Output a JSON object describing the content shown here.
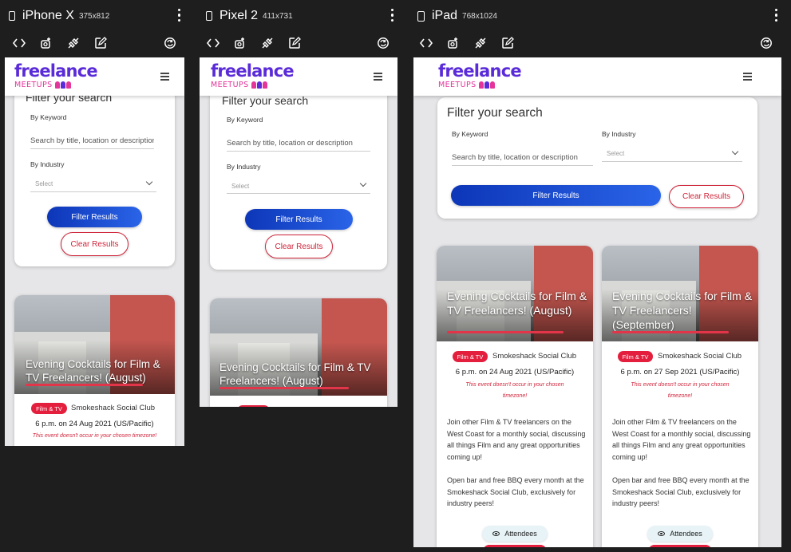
{
  "devices": [
    {
      "name": "iPhone X",
      "dims": "375x812"
    },
    {
      "name": "Pixel 2",
      "dims": "411x731"
    },
    {
      "name": "iPad",
      "dims": "768x1024"
    }
  ],
  "toolbar_icons": [
    "code-icon",
    "camera-icon",
    "plug-icon",
    "edit-icon",
    "rotate-icon"
  ],
  "site": {
    "logo_main": "freelance",
    "logo_sub": "MEETUPS",
    "brand_colors": {
      "logo_purple": "#5a2bd8",
      "logo_pink": "#e3359a",
      "accent_red": "#e31f3d",
      "button_blue": "#1a48cc"
    }
  },
  "filter": {
    "title": "Filter your search",
    "keyword_label": "By Keyword",
    "keyword_placeholder": "Search by title, location or description",
    "industry_label": "By Industry",
    "industry_value": "Select",
    "filter_button": "Filter Results",
    "clear_button": "Clear Results"
  },
  "events": [
    {
      "title": "Evening Cocktails for Film & TV Freelancers! (August)",
      "tag": "Film & TV",
      "venue": "Smokeshack Social Club",
      "time_prefix": "6 p.m. on",
      "date": "24 Aug 2021",
      "tz": "(US/Pacific)",
      "warning": "This event doesn't occur in your chosen timezone!",
      "desc1": "Join other Film & TV freelancers on the West Coast for a monthly social, discussing all things Film and any great opportunities coming up!",
      "desc2": "Open bar and free BBQ every month at the Smokeshack Social Club, exclusively for industry peers!",
      "attendees_label": "Attendees"
    },
    {
      "title": "Evening Cocktails for Film & TV Freelancers! (September)",
      "tag": "Film & TV",
      "venue": "Smokeshack Social Club",
      "time_prefix": "6 p.m. on",
      "date": "27 Sep 2021",
      "tz": "(US/Pacific)",
      "warning": "This event doesn't occur in your chosen timezone!",
      "desc1": "Join other Film & TV freelancers on the West Coast for a monthly social, discussing all things Film and any great opportunities coming up!",
      "desc2": "Open bar and free BBQ every month at the Smokeshack Social Club, exclusively for industry peers!",
      "attendees_label": "Attendees"
    }
  ]
}
